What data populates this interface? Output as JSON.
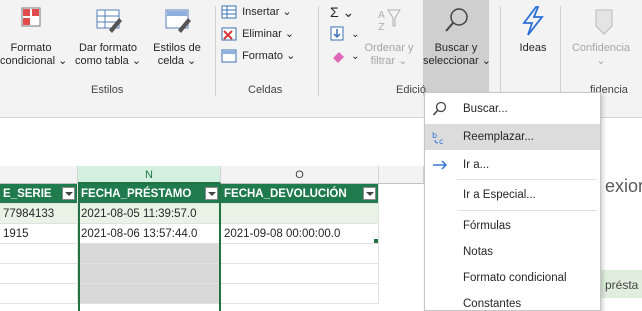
{
  "ribbon": {
    "format_condicional": [
      "Formato",
      "condicional ⌄"
    ],
    "dar_formato": [
      "Dar formato",
      "como tabla ⌄"
    ],
    "estilos_celda": [
      "Estilos de",
      "celda ⌄"
    ],
    "estilos_label": "Estilos",
    "insertar": "Insertar ⌄",
    "eliminar": "Eliminar ⌄",
    "formato": "Formato ⌄",
    "celdas_label": "Celdas",
    "sigma": "Σ ⌄",
    "ordenar": [
      "Ordenar y",
      "filtrar ⌄"
    ],
    "buscar": [
      "Buscar y",
      "seleccionar ⌄"
    ],
    "edicion_label": "Edició",
    "ideas": "Ideas",
    "confidencial": [
      "Confidencia",
      ""
    ],
    "confidencial_label": "fidencia"
  },
  "grid": {
    "columns": [
      {
        "letter": "N",
        "selected": true
      },
      {
        "letter": "O",
        "selected": false
      }
    ],
    "headers": [
      "E_SERIE",
      "FECHA_PRÉSTAMO",
      "FECHA_DEVOLUCIÓN"
    ],
    "rows": [
      [
        "77984133",
        "2021-08-05 11:39:57.0",
        ""
      ],
      [
        "1915",
        "2021-08-06 13:57:44.0",
        "2021-09-08 00:00:00.0"
      ]
    ]
  },
  "menu": {
    "items": [
      {
        "label": "Buscar...",
        "icon": "search-icon"
      },
      {
        "label": "Reemplazar...",
        "icon": "replace-icon"
      },
      {
        "label": "Ir a...",
        "icon": "arrow-right-icon"
      },
      {
        "label": "Ir a Especial...",
        "icon": ""
      },
      {
        "label": "Fórmulas",
        "icon": ""
      },
      {
        "label": "Notas",
        "icon": ""
      },
      {
        "label": "Formato condicional",
        "icon": ""
      },
      {
        "label": "Constantes",
        "icon": ""
      }
    ]
  },
  "right_panel": {
    "text1": "exior",
    "text2": "présta"
  },
  "colors": {
    "header_green": "#1f7a4d",
    "accent": "#217346"
  }
}
